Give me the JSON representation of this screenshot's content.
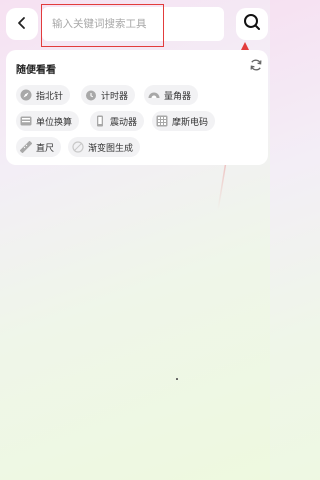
{
  "header": {
    "back_icon": "chevron-left-icon",
    "search_placeholder": "输入关键词搜索工具",
    "search_value": "",
    "search_icon": "search-icon"
  },
  "suggestions": {
    "title": "随便看看",
    "refresh_icon": "refresh-icon",
    "items": [
      {
        "label": "指北针",
        "icon": "compass-icon"
      },
      {
        "label": "计时器",
        "icon": "timer-icon"
      },
      {
        "label": "量角器",
        "icon": "protractor-icon"
      },
      {
        "label": "单位换算",
        "icon": "calculator-icon"
      },
      {
        "label": "震动器",
        "icon": "vibrate-icon"
      },
      {
        "label": "摩斯电码",
        "icon": "grid-icon"
      },
      {
        "label": "直尺",
        "icon": "ruler-icon"
      },
      {
        "label": "渐变图生成",
        "icon": "gradient-icon"
      }
    ]
  },
  "colors": {
    "annotation": "#e23c3c",
    "icon_gray": "#9a9a9a"
  }
}
